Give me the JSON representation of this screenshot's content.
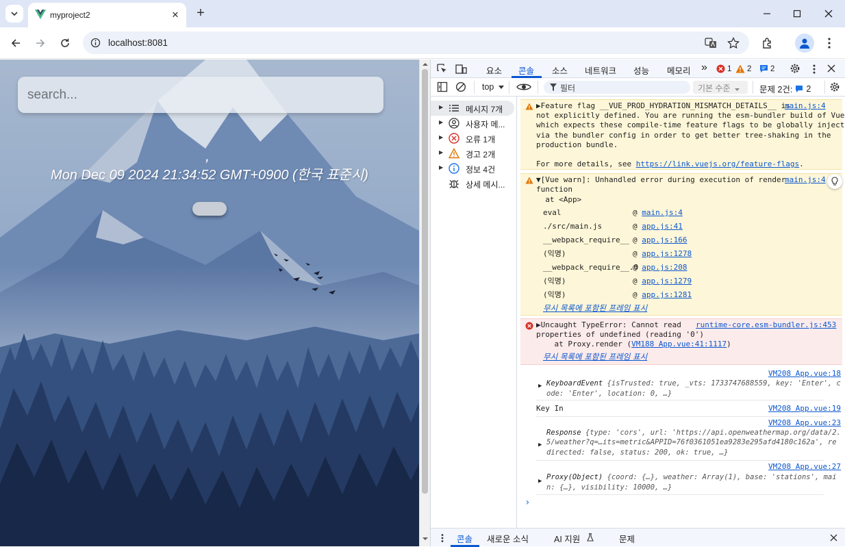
{
  "browser": {
    "tab_title": "myproject2",
    "url": "localhost:8081",
    "new_tab_symbol": "+",
    "tab_close_symbol": "✕"
  },
  "page": {
    "search_placeholder": "search...",
    "location_text": ",",
    "date_text": "Mon Dec 09 2024 21:34:52 GMT+0900 (한국 표준시)"
  },
  "devtools": {
    "tabs": [
      "요소",
      "콘솔",
      "소스",
      "네트워크",
      "성능",
      "메모리"
    ],
    "more_tabs": "»",
    "error_count": "1",
    "warning_count": "2",
    "info_count": "2",
    "context": "top",
    "filter_placeholder": "필터",
    "levels_label": "기본 수준",
    "issues_label": "문제 2건:",
    "issues_count": "2",
    "sidebar": [
      {
        "label": "메시지 7개",
        "icon": "list-icon"
      },
      {
        "label": "사용자 메...",
        "icon": "user-icon"
      },
      {
        "label": "오류 1개",
        "icon": "error-icon"
      },
      {
        "label": "경고 2개",
        "icon": "warning-icon"
      },
      {
        "label": "정보 4건",
        "icon": "info-icon"
      },
      {
        "label": "상세 메시...",
        "icon": "bug-icon"
      }
    ],
    "messages": {
      "warn1": {
        "source": "main.js:4",
        "line1": "Feature flag __VUE_PROD_HYDRATION_MISMATCH_DETAILS__ is",
        "line2": "not explicitly defined. You are running the esm-bundler build of Vue,",
        "line3": "which expects these compile-time feature flags to be globally injected",
        "line4": "via the bundler config in order to get better tree-shaking in the",
        "line5": "production bundle.",
        "line6_prefix": "For more details, see ",
        "line6_link": "https://link.vuejs.org/feature-flags",
        "line6_suffix": "."
      },
      "warn2": {
        "source": "main.js:4",
        "line1": "[Vue warn]: Unhandled error during execution of render",
        "line2": "function",
        "line3": "  at <App>",
        "stack": [
          {
            "fn": "eval",
            "loc": "main.js:4"
          },
          {
            "fn": "./src/main.js",
            "loc": "app.js:41"
          },
          {
            "fn": "__webpack_require__",
            "loc": "app.js:166"
          },
          {
            "fn": "(익명)",
            "loc": "app.js:1278"
          },
          {
            "fn": "__webpack_require__.O",
            "loc": "app.js:208"
          },
          {
            "fn": "(익명)",
            "loc": "app.js:1279"
          },
          {
            "fn": "(익명)",
            "loc": "app.js:1281"
          }
        ],
        "ignored_frames": "무시 목록에 포함된 프레임 표시"
      },
      "error": {
        "source": "runtime-core.esm-bundler.js:453",
        "line1": "Uncaught TypeError: Cannot read",
        "line2": "properties of undefined (reading '0')",
        "line3_prefix": "    at Proxy.render (",
        "line3_link": "VM188 App.vue:41:1117",
        "line3_suffix": ")",
        "ignored_frames": "무시 목록에 포함된 프레임 표시"
      },
      "log1": {
        "source": "VM208 App.vue:18",
        "line1_type": "KeyboardEvent",
        "line1_rest": " {isTrusted: true, _vts: 1733747688559, key: 'Enter', c",
        "line2": "ode: 'Enter', location: 0, …}"
      },
      "log2": {
        "text": "Key In",
        "source": "VM208 App.vue:19"
      },
      "log3": {
        "source": "VM208 App.vue:23",
        "line1_type": "Response",
        "line1_rest": " {type: 'cors', url: 'https://api.openweathermap.org/data/2.",
        "line2": "5/weather?q=…its=metric&APPID=76f0361051ea9283e295afd4180c162a', re",
        "line3": "directed: false, status: 200, ok: true, …}"
      },
      "log4": {
        "source": "VM208 App.vue:27",
        "line1_type": "Proxy(Object)",
        "line1_rest": " {coord: {…}, weather: Array(1), base: 'stations', mai",
        "line2": "n: {…}, visibility: 10000, …}"
      },
      "prompt": "›"
    },
    "bottom_tabs": [
      "콘솔",
      "새로운 소식",
      "AI 지원",
      "문제"
    ]
  },
  "colors": {
    "accent": "#0b57d0",
    "error": "#d93025",
    "warning": "#e37400"
  }
}
